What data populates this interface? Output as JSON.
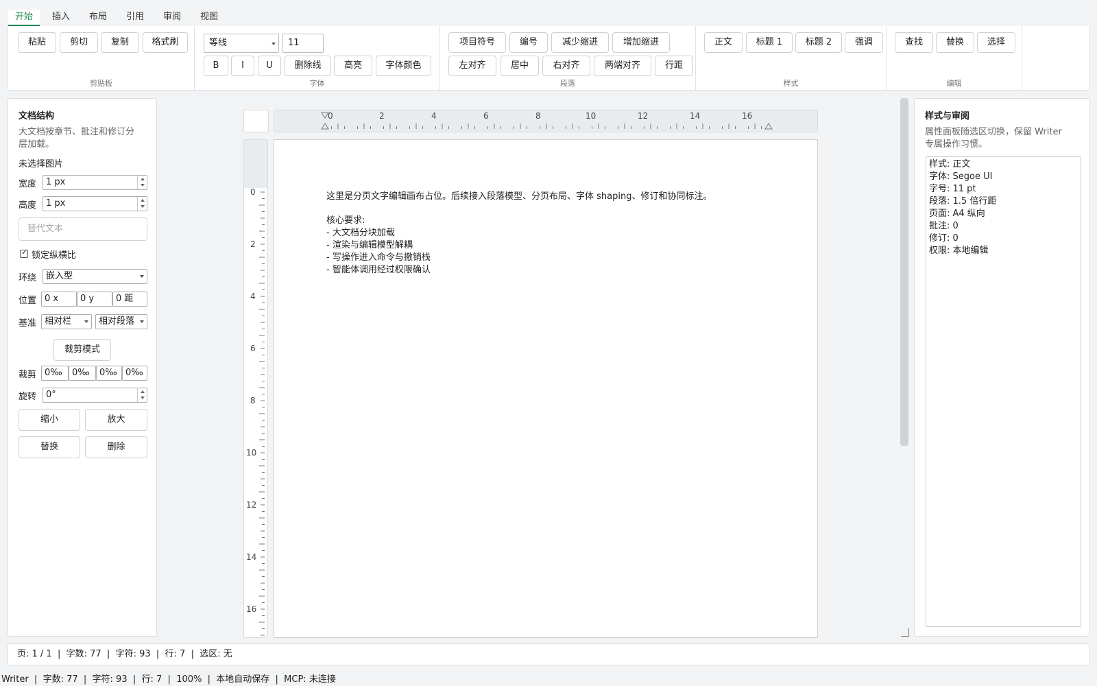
{
  "tabs": [
    "开始",
    "插入",
    "布局",
    "引用",
    "审阅",
    "视图"
  ],
  "active_tab": "开始",
  "ribbon": {
    "clipboard": {
      "label": "剪贴板",
      "buttons": [
        "粘贴",
        "剪切",
        "复制",
        "格式刷"
      ]
    },
    "font": {
      "label": "字体",
      "font_name": "等线",
      "font_size": "11",
      "buttons": [
        "B",
        "I",
        "U",
        "删除线",
        "高亮",
        "字体颜色"
      ]
    },
    "paragraph": {
      "label": "段落",
      "row1": [
        "项目符号",
        "编号",
        "减少缩进",
        "增加缩进"
      ],
      "row2": [
        "左对齐",
        "居中",
        "右对齐",
        "两端对齐",
        "行距"
      ]
    },
    "styles": {
      "label": "样式",
      "buttons": [
        "正文",
        "标题 1",
        "标题 2",
        "强调"
      ]
    },
    "editing": {
      "label": "编辑",
      "buttons": [
        "查找",
        "替换",
        "选择"
      ]
    }
  },
  "left_panel": {
    "title": "文档结构",
    "desc_line1": "大文档按章节、批注和修订分",
    "desc_line2": "层加载。",
    "no_image": "未选择图片",
    "width_label": "宽度",
    "width_value": "1 px",
    "height_label": "高度",
    "height_value": "1 px",
    "alt_placeholder": "替代文本",
    "lock_ratio": "锁定纵横比",
    "wrap_label": "环绕",
    "wrap_value": "嵌入型",
    "position_label": "位置",
    "pos_x": "0 x",
    "pos_y": "0 y",
    "pos_dist": "0 距",
    "basis_label": "基准",
    "basis_h": "相对栏",
    "basis_v": "相对段落",
    "crop_mode": "裁剪模式",
    "crop_label": "裁剪",
    "crop_values": [
      "0‰",
      "0‰",
      "0‰",
      "0‰"
    ],
    "rotate_label": "旋转",
    "rotate_value": "0°",
    "shrink": "缩小",
    "enlarge": "放大",
    "replace": "替换",
    "delete": "删除"
  },
  "ruler": {
    "h_ticks": [
      "0",
      "2",
      "4",
      "6",
      "8",
      "10",
      "12",
      "14",
      "16"
    ],
    "v_ticks": [
      "0",
      "2",
      "4",
      "6",
      "8",
      "10",
      "12",
      "14",
      "16"
    ]
  },
  "document": {
    "paragraph1": "这里是分页文字编辑画布占位。后续接入段落模型、分页布局、字体 shaping、修订和协同标注。",
    "heading": "核心要求:",
    "items": [
      "- 大文档分块加载",
      "- 渲染与编辑模型解耦",
      "- 写操作进入命令与撤销栈",
      "- 智能体调用经过权限确认"
    ]
  },
  "right_panel": {
    "title": "样式与审阅",
    "desc_line1": "属性面板随选区切换，保留 Writer",
    "desc_line2": "专属操作习惯。",
    "info": [
      "样式: 正文",
      "字体: Segoe UI",
      "字号: 11 pt",
      "段落: 1.5 倍行距",
      "页面: A4 纵向",
      "批注: 0",
      "修订: 0",
      "权限: 本地编辑"
    ]
  },
  "status_bar": "页: 1 / 1  |  字数: 77  |  字符: 93  |  行: 7  |  选区: 无",
  "bottom_bar": "Writer  |  字数: 77  |  字符: 93  |  行: 7  |  100%  |  本地自动保存  |  MCP: 未连接",
  "colors": {
    "accent": "#1f8a52"
  }
}
